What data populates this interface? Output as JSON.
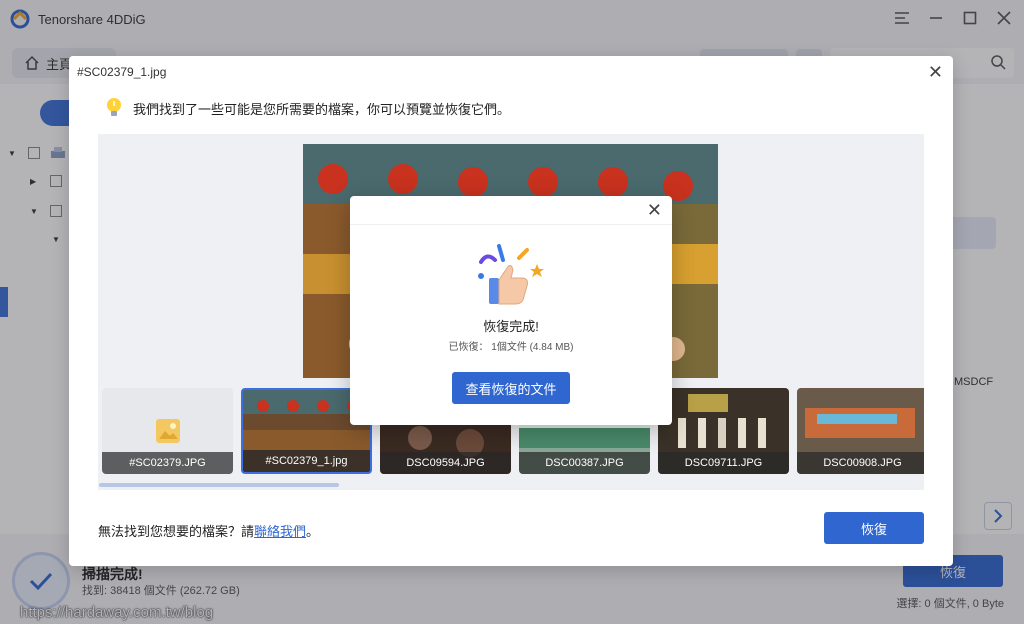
{
  "app": {
    "title": "Tenorshare 4DDiG",
    "home_label": "主頁"
  },
  "main": {
    "side_label": "MSDCF"
  },
  "status": {
    "scan_title": "掃描完成!",
    "found": "找到: 38418 個文件 (262.72 GB)",
    "recover_label": "恢復",
    "selected": "選擇: 0 個文件, 0 Byte",
    "watermark": "https://hardaway.com.tw/blog"
  },
  "preview": {
    "title": "#SC02379_1.jpg",
    "hint": "我們找到了一些可能是您所需要的檔案，你可以預覽並恢復它們。",
    "thumbnails": [
      {
        "label": "#SC02379.JPG"
      },
      {
        "label": "#SC02379_1.jpg"
      },
      {
        "label": "DSC09594.JPG"
      },
      {
        "label": "DSC00387.JPG"
      },
      {
        "label": "DSC09711.JPG"
      },
      {
        "label": "DSC00908.JPG"
      }
    ],
    "not_found_prefix": "無法找到您想要的檔案？請",
    "contact_link": "聯絡我們",
    "not_found_suffix": "。",
    "recover_label": "恢復"
  },
  "success": {
    "title": "恢復完成!",
    "detail": "已恢復： 1個文件 (4.84 MB)",
    "view_button": "查看恢復的文件"
  },
  "colors": {
    "accent": "#2f66d0",
    "dim": "rgba(40,40,50,0.35)"
  },
  "icons": [
    "app-logo-icon",
    "menu-icon",
    "minimize-icon",
    "maximize-icon",
    "close-icon",
    "home-icon",
    "search-icon",
    "lightbulb-icon",
    "image-placeholder-icon",
    "thumbs-up-celebration-icon",
    "check-icon",
    "chevron-right-icon"
  ]
}
